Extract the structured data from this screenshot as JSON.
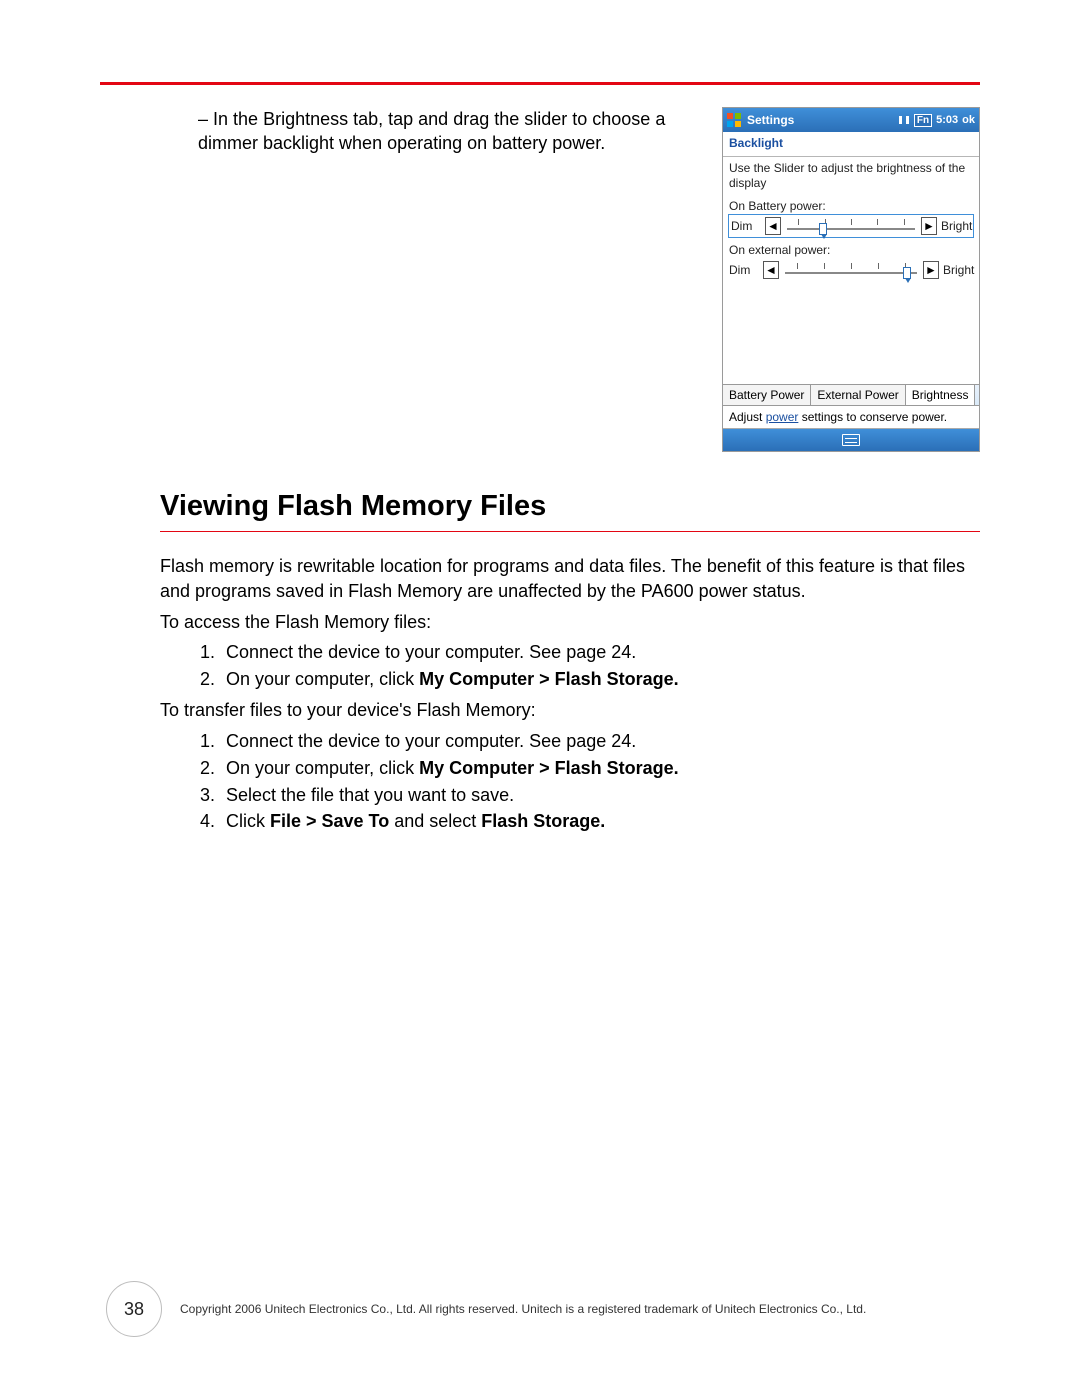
{
  "topInstruction": {
    "dash": "–",
    "text": "In the Brightness tab, tap and drag the slider to choose a dimmer backlight when operating on battery power."
  },
  "screenshot": {
    "titlebar": {
      "title": "Settings",
      "fn": "Fn",
      "time": "5:03",
      "ok": "ok"
    },
    "subtitle": "Backlight",
    "desc": "Use the Slider to adjust the brightness of the display",
    "battery": {
      "label": "On Battery power:",
      "dim": "Dim",
      "bright": "Bright",
      "value": 0.3
    },
    "external": {
      "label": "On external power:",
      "dim": "Dim",
      "bright": "Bright",
      "value": 0.95
    },
    "tabs": {
      "battery": "Battery Power",
      "external": "External Power",
      "brightness": "Brightness"
    },
    "hint": {
      "prefix": "Adjust ",
      "link": "power",
      "suffix": " settings to conserve power."
    }
  },
  "heading": "Viewing Flash Memory Files",
  "intro": "Flash memory is rewritable location for programs and data files. The benefit of this feature is that files and programs saved in Flash Memory are unaffected by the PA600 power status.",
  "access": {
    "lead": "To access the Flash Memory files:",
    "step1": "Connect the device to your computer. See page 24.",
    "step2_prefix": "On your computer, click ",
    "step2_bold": "My Computer > Flash Storage."
  },
  "transfer": {
    "lead": "To transfer files to your device's Flash Memory:",
    "step1": "Connect the device to your computer. See page 24.",
    "step2_prefix": "On your computer, click ",
    "step2_bold": "My Computer > Flash Storage.",
    "step3": "Select the file that you want to save.",
    "step4_prefix": "Click ",
    "step4_bold1": "File > Save To",
    "step4_mid": " and select ",
    "step4_bold2": "Flash Storage."
  },
  "footer": {
    "pageNumber": "38",
    "copyright": "Copyright 2006 Unitech Electronics Co., Ltd. All rights reserved. Unitech is a registered trademark of Unitech Electronics Co., Ltd."
  }
}
